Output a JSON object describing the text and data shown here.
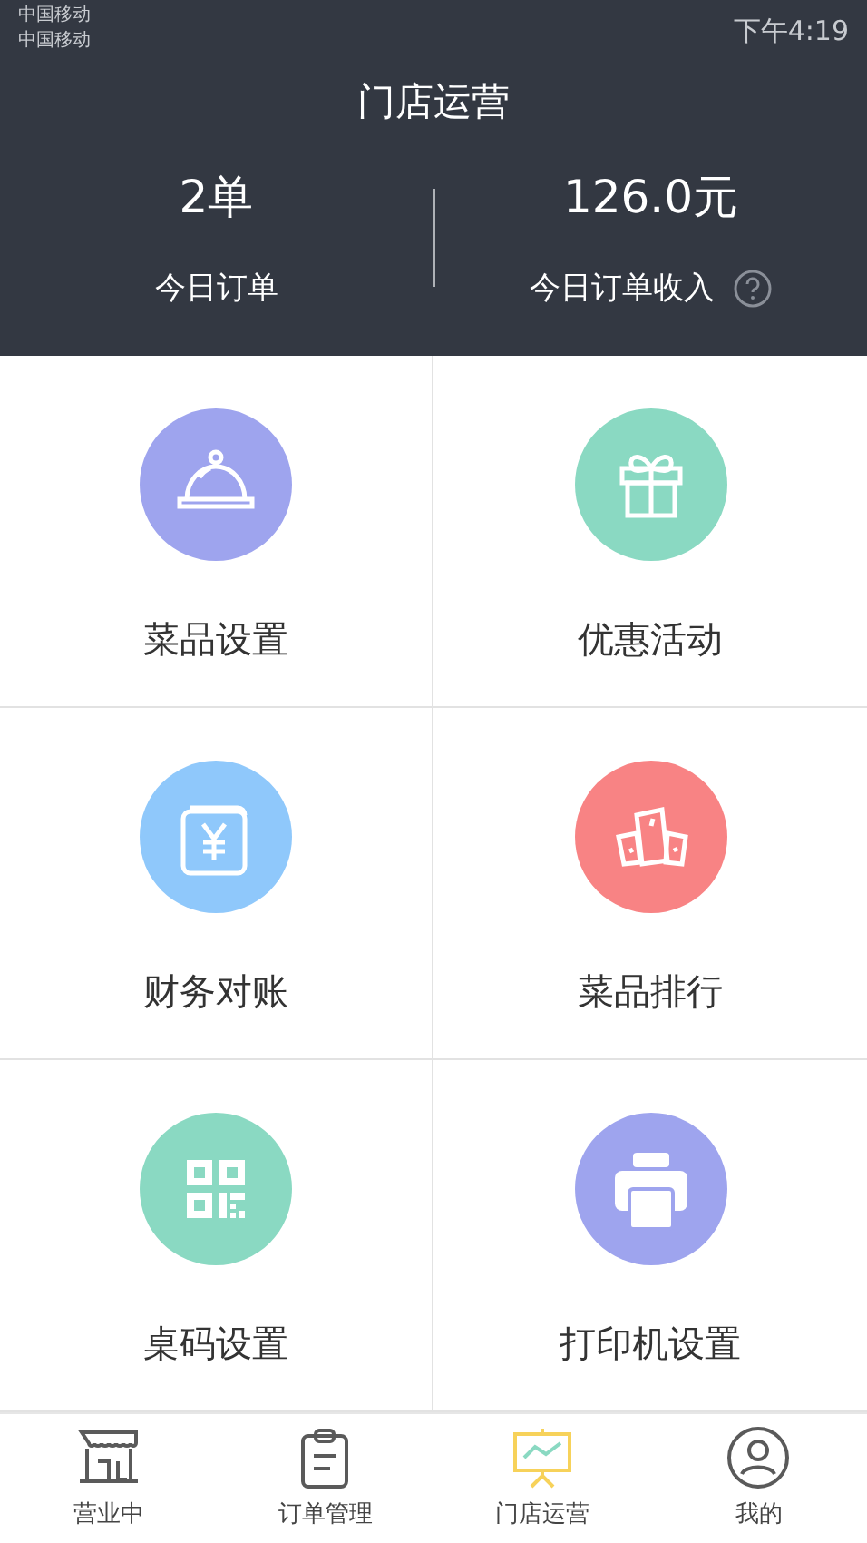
{
  "status_bar": {
    "carriers": [
      "中国移动",
      "中国移动"
    ],
    "time": "下午4:19"
  },
  "header": {
    "title": "门店运营"
  },
  "stats": [
    {
      "value": "2单",
      "label": "今日订单",
      "help": false
    },
    {
      "value": "126.0元",
      "label": "今日订单收入",
      "help": true
    }
  ],
  "tiles": [
    {
      "kind": "cloche",
      "label": "菜品设置",
      "color": "#9ea4ee"
    },
    {
      "kind": "gift",
      "label": "优惠活动",
      "color": "#8ad9c2"
    },
    {
      "kind": "yen",
      "label": "财务对账",
      "color": "#8fc8fb"
    },
    {
      "kind": "podium",
      "label": "菜品排行",
      "color": "#f88384"
    },
    {
      "kind": "qr",
      "label": "桌码设置",
      "color": "#8ad9c2"
    },
    {
      "kind": "printer",
      "label": "打印机设置",
      "color": "#9ea4ee"
    }
  ],
  "tab_bar": [
    {
      "kind": "shop",
      "label": "营业中",
      "selected": false
    },
    {
      "kind": "order",
      "label": "订单管理",
      "selected": false
    },
    {
      "kind": "board",
      "label": "门店运营",
      "selected": true
    },
    {
      "kind": "user",
      "label": "我的",
      "selected": false
    }
  ]
}
